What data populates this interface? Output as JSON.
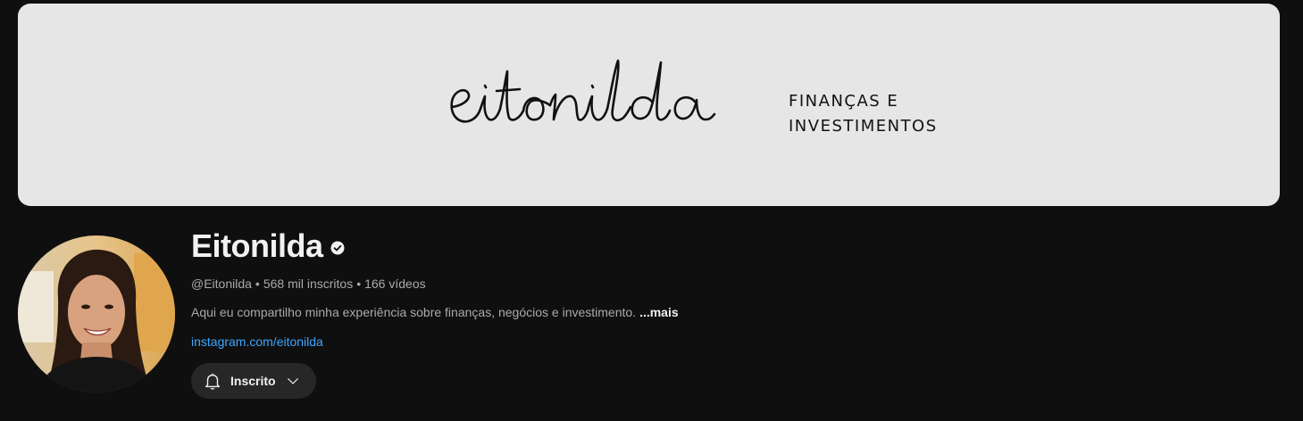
{
  "banner": {
    "logo_text": "eitonilda",
    "tagline_line1": "Finanças e",
    "tagline_line2": "Investimentos"
  },
  "channel": {
    "name": "Eitonilda",
    "handle": "@Eitonilda",
    "subscribers": "568 mil inscritos",
    "videos": "166 vídeos",
    "separator": "•",
    "description": "Aqui eu compartilho minha experiência sobre finanças, negócios e investimento.",
    "more_label": "...mais",
    "link": "instagram.com/eitonilda"
  },
  "subscribe": {
    "label": "Inscrito"
  },
  "icons": {
    "verified": "verified-check-icon",
    "bell": "bell-icon",
    "chevron": "chevron-down-icon"
  },
  "colors": {
    "background": "#0f0f0f",
    "banner": "#e6e6e6",
    "link": "#3ea6ff",
    "button": "#272727"
  }
}
